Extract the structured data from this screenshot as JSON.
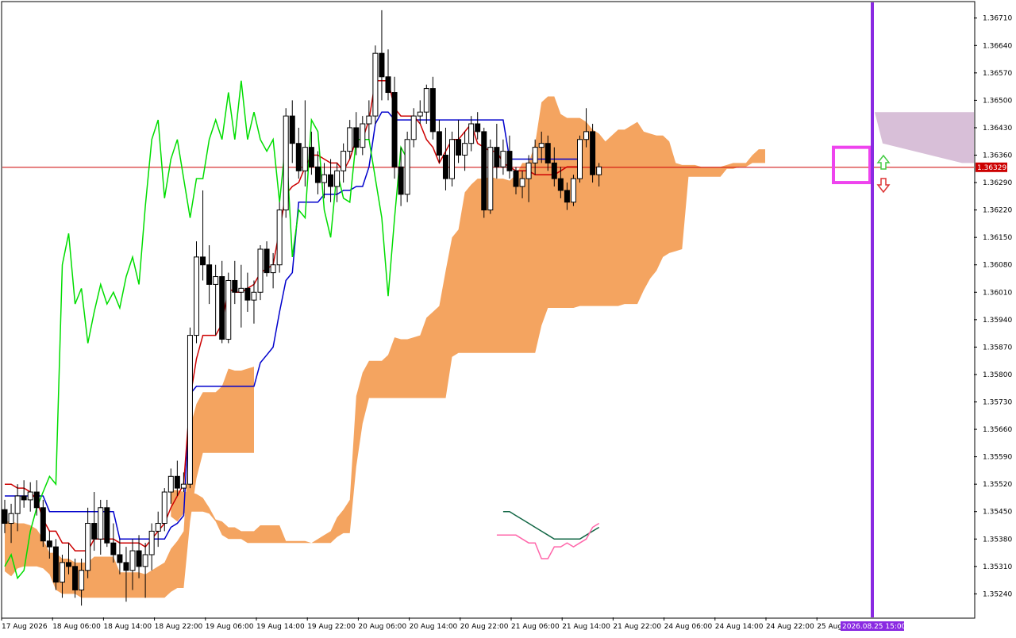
{
  "chart_data": {
    "type": "candlestick",
    "symbol_price_label": "1.36329",
    "current_price": 1.36329,
    "ylim": [
      1.3518,
      1.3675
    ],
    "yticks": [
      "1.36710",
      "1.36640",
      "1.36570",
      "1.36500",
      "1.36430",
      "1.36360",
      "1.36290",
      "1.36220",
      "1.36150",
      "1.36080",
      "1.36010",
      "1.35940",
      "1.35870",
      "1.35800",
      "1.35730",
      "1.35660",
      "1.35590",
      "1.35520",
      "1.35450",
      "1.35380",
      "1.35310",
      "1.35240"
    ],
    "xticks": [
      "17 Aug 2026",
      "18 Aug 06:00",
      "18 Aug 14:00",
      "18 Aug 22:00",
      "19 Aug 06:00",
      "19 Aug 14:00",
      "19 Aug 22:00",
      "20 Aug 06:00",
      "20 Aug 14:00",
      "20 Aug 22:00",
      "21 Aug 06:00",
      "21 Aug 14:00",
      "21 Aug 22:00",
      "24 Aug 06:00",
      "24 Aug 14:00",
      "24 Aug 22:00",
      "25 Aug"
    ],
    "cursor_time_label": "2026.08.25 15:00",
    "grid": false,
    "colors": {
      "tenkan": "#cc0000",
      "kijun": "#0000cc",
      "chikou": "#00dd00",
      "cloud_bull": "#f4a460",
      "cloud_bear": "#d8bfd8",
      "cursor": "#8a2be2",
      "price_line": "#cc0000",
      "box": "#ee44ee",
      "ma_fast": "#ff66aa",
      "ma_slow": "#116644",
      "arrow_up": "#44cc44",
      "arrow_down": "#dd3333"
    },
    "candles": [
      [
        1.35455,
        1.3548,
        1.35395,
        1.3542
      ],
      [
        1.3542,
        1.3547,
        1.3537,
        1.35445
      ],
      [
        1.35445,
        1.3552,
        1.354,
        1.3549
      ],
      [
        1.3549,
        1.3553,
        1.3546,
        1.3548
      ],
      [
        1.3548,
        1.35525,
        1.3545,
        1.355
      ],
      [
        1.355,
        1.3553,
        1.3544,
        1.3546
      ],
      [
        1.3546,
        1.3548,
        1.3536,
        1.35375
      ],
      [
        1.35375,
        1.354,
        1.3533,
        1.3536
      ],
      [
        1.3536,
        1.3538,
        1.3525,
        1.3527
      ],
      [
        1.3527,
        1.3534,
        1.3523,
        1.3532
      ],
      [
        1.3532,
        1.3537,
        1.3529,
        1.3531
      ],
      [
        1.3531,
        1.3533,
        1.3523,
        1.3525
      ],
      [
        1.3525,
        1.3533,
        1.3521,
        1.353
      ],
      [
        1.353,
        1.3546,
        1.3528,
        1.3542
      ],
      [
        1.3542,
        1.355,
        1.3535,
        1.3538
      ],
      [
        1.3538,
        1.3548,
        1.3534,
        1.3546
      ],
      [
        1.3546,
        1.3548,
        1.3536,
        1.3537
      ],
      [
        1.3537,
        1.3542,
        1.3532,
        1.3534
      ],
      [
        1.3534,
        1.3538,
        1.3529,
        1.3532
      ],
      [
        1.3532,
        1.3536,
        1.3522,
        1.353
      ],
      [
        1.353,
        1.3538,
        1.3525,
        1.3535
      ],
      [
        1.3535,
        1.3539,
        1.3528,
        1.3531
      ],
      [
        1.3531,
        1.3537,
        1.3523,
        1.3534
      ],
      [
        1.3534,
        1.3542,
        1.353,
        1.354
      ],
      [
        1.354,
        1.3545,
        1.3536,
        1.3542
      ],
      [
        1.3542,
        1.3551,
        1.354,
        1.355
      ],
      [
        1.355,
        1.3556,
        1.3547,
        1.3554
      ],
      [
        1.3554,
        1.3558,
        1.3549,
        1.3551
      ],
      [
        1.3551,
        1.3555,
        1.355,
        1.3552
      ],
      [
        1.3552,
        1.3592,
        1.3551,
        1.359
      ],
      [
        1.359,
        1.3614,
        1.3588,
        1.361
      ],
      [
        1.361,
        1.3627,
        1.3604,
        1.3608
      ],
      [
        1.3608,
        1.3613,
        1.3598,
        1.3603
      ],
      [
        1.3603,
        1.3608,
        1.359,
        1.3605
      ],
      [
        1.3605,
        1.3609,
        1.3588,
        1.3589
      ],
      [
        1.3589,
        1.3606,
        1.3588,
        1.3604
      ],
      [
        1.3604,
        1.3609,
        1.3598,
        1.3601
      ],
      [
        1.3601,
        1.3608,
        1.3592,
        1.3602
      ],
      [
        1.3602,
        1.3606,
        1.3596,
        1.3599
      ],
      [
        1.3599,
        1.3604,
        1.3593,
        1.3601
      ],
      [
        1.3601,
        1.3613,
        1.3599,
        1.3612
      ],
      [
        1.3612,
        1.3614,
        1.3605,
        1.3606
      ],
      [
        1.3606,
        1.3611,
        1.3602,
        1.3608
      ],
      [
        1.3608,
        1.3624,
        1.3606,
        1.3622
      ],
      [
        1.3622,
        1.3648,
        1.362,
        1.3646
      ],
      [
        1.3646,
        1.365,
        1.3634,
        1.3639
      ],
      [
        1.3639,
        1.3643,
        1.363,
        1.3632
      ],
      [
        1.3632,
        1.365,
        1.3628,
        1.3638
      ],
      [
        1.3638,
        1.3642,
        1.3631,
        1.3633
      ],
      [
        1.3633,
        1.3637,
        1.3626,
        1.3629
      ],
      [
        1.3629,
        1.3634,
        1.3625,
        1.3631
      ],
      [
        1.3631,
        1.3635,
        1.3624,
        1.3628
      ],
      [
        1.3628,
        1.3634,
        1.3624,
        1.3632
      ],
      [
        1.3632,
        1.3639,
        1.3629,
        1.3637
      ],
      [
        1.3637,
        1.3645,
        1.3635,
        1.3643
      ],
      [
        1.3643,
        1.3647,
        1.3636,
        1.3638
      ],
      [
        1.3638,
        1.3646,
        1.3636,
        1.3644
      ],
      [
        1.3644,
        1.365,
        1.364,
        1.3646
      ],
      [
        1.3646,
        1.3664,
        1.3644,
        1.3662
      ],
      [
        1.3662,
        1.3673,
        1.365,
        1.3656
      ],
      [
        1.3656,
        1.3663,
        1.365,
        1.3652
      ],
      [
        1.3652,
        1.3656,
        1.363,
        1.3633
      ],
      [
        1.3633,
        1.3638,
        1.3623,
        1.3626
      ],
      [
        1.3626,
        1.3642,
        1.3624,
        1.364
      ],
      [
        1.364,
        1.3648,
        1.3638,
        1.3646
      ],
      [
        1.3646,
        1.365,
        1.3644,
        1.3647
      ],
      [
        1.3647,
        1.3654,
        1.3644,
        1.3653
      ],
      [
        1.3653,
        1.3656,
        1.364,
        1.3642
      ],
      [
        1.3642,
        1.3645,
        1.3634,
        1.3636
      ],
      [
        1.3636,
        1.3643,
        1.3627,
        1.363
      ],
      [
        1.363,
        1.3642,
        1.3628,
        1.364
      ],
      [
        1.364,
        1.3645,
        1.3634,
        1.3636
      ],
      [
        1.3636,
        1.3642,
        1.3632,
        1.3639
      ],
      [
        1.3639,
        1.3646,
        1.3637,
        1.3644
      ],
      [
        1.3644,
        1.3647,
        1.364,
        1.3642
      ],
      [
        1.3642,
        1.3643,
        1.362,
        1.3622
      ],
      [
        1.3622,
        1.364,
        1.3621,
        1.3638
      ],
      [
        1.3638,
        1.3644,
        1.363,
        1.3633
      ],
      [
        1.3633,
        1.364,
        1.3631,
        1.3637
      ],
      [
        1.3637,
        1.3641,
        1.363,
        1.3632
      ],
      [
        1.3632,
        1.3633,
        1.3626,
        1.3628
      ],
      [
        1.3628,
        1.3632,
        1.3625,
        1.363
      ],
      [
        1.363,
        1.3636,
        1.3624,
        1.3634
      ],
      [
        1.3634,
        1.364,
        1.3631,
        1.3638
      ],
      [
        1.3638,
        1.3642,
        1.3634,
        1.3639
      ],
      [
        1.3639,
        1.3641,
        1.3632,
        1.3634
      ],
      [
        1.3634,
        1.3638,
        1.3628,
        1.363
      ],
      [
        1.363,
        1.3633,
        1.3625,
        1.3627
      ],
      [
        1.3627,
        1.3629,
        1.3622,
        1.3624
      ],
      [
        1.3624,
        1.3631,
        1.3623,
        1.363
      ],
      [
        1.363,
        1.3641,
        1.3629,
        1.364
      ],
      [
        1.364,
        1.3648,
        1.3638,
        1.3642
      ],
      [
        1.3642,
        1.3644,
        1.3629,
        1.3631
      ],
      [
        1.3631,
        1.3634,
        1.3628,
        1.3633
      ]
    ],
    "tenkan": [
      1.3552,
      1.3552,
      1.3551,
      1.3551,
      1.355,
      1.3548,
      1.3543,
      1.354,
      1.354,
      1.3537,
      1.3537,
      1.3535,
      1.3535,
      1.3535,
      1.3538,
      1.3538,
      1.3538,
      1.3538,
      1.3537,
      1.3537,
      1.3537,
      1.3537,
      1.3536,
      1.3538,
      1.354,
      1.3542,
      1.3546,
      1.3549,
      1.3552,
      1.3574,
      1.3584,
      1.359,
      1.359,
      1.359,
      1.3593,
      1.3602,
      1.3601,
      1.3601,
      1.3602,
      1.3603,
      1.3606,
      1.3607,
      1.3608,
      1.3617,
      1.3626,
      1.3628,
      1.3629,
      1.3633,
      1.3636,
      1.3636,
      1.3635,
      1.3634,
      1.3634,
      1.3632,
      1.3635,
      1.364,
      1.364,
      1.3645,
      1.3655,
      1.3655,
      1.3655,
      1.3648,
      1.3646,
      1.3646,
      1.3646,
      1.3644,
      1.364,
      1.3638,
      1.3634,
      1.3637,
      1.364,
      1.364,
      1.3642,
      1.3644,
      1.3639,
      1.3638,
      1.3637,
      1.3637,
      1.3634,
      1.3633,
      1.3632,
      1.3632,
      1.3632,
      1.3631,
      1.3631,
      1.3631,
      1.3631,
      1.3632,
      1.3633,
      1.3633,
      1.3633
    ],
    "kijun": [
      1.3549,
      1.3549,
      1.3549,
      1.3549,
      1.3549,
      1.3549,
      1.3549,
      1.3545,
      1.3545,
      1.3545,
      1.3545,
      1.3545,
      1.3545,
      1.3545,
      1.3545,
      1.3545,
      1.3545,
      1.3545,
      1.3538,
      1.3538,
      1.3538,
      1.3538,
      1.3538,
      1.3538,
      1.3538,
      1.3538,
      1.3541,
      1.3542,
      1.3544,
      1.3575,
      1.3577,
      1.3577,
      1.3577,
      1.3577,
      1.3577,
      1.3577,
      1.3577,
      1.3577,
      1.3577,
      1.3577,
      1.3583,
      1.3585,
      1.3587,
      1.3596,
      1.3604,
      1.3606,
      1.3624,
      1.3624,
      1.3624,
      1.3624,
      1.3626,
      1.3626,
      1.3626,
      1.3627,
      1.3627,
      1.3628,
      1.3628,
      1.3633,
      1.3644,
      1.3647,
      1.3647,
      1.3645,
      1.3645,
      1.3645,
      1.3645,
      1.3645,
      1.3645,
      1.3645,
      1.3645,
      1.3645,
      1.3645,
      1.3645,
      1.3645,
      1.3645,
      1.3645,
      1.3645,
      1.3645,
      1.3645,
      1.3645,
      1.3635,
      1.3635,
      1.3635,
      1.3635,
      1.3635,
      1.3635,
      1.3635,
      1.3635,
      1.3635,
      1.3635,
      1.3635,
      1.3635
    ],
    "chikou": [
      1.3531,
      1.3534,
      1.3528,
      1.353,
      1.354,
      1.3546,
      1.355,
      1.3554,
      1.3552,
      1.3608,
      1.3616,
      1.3598,
      1.3602,
      1.3588,
      1.3596,
      1.3603,
      1.3598,
      1.3601,
      1.3597,
      1.3605,
      1.361,
      1.3603,
      1.3623,
      1.364,
      1.3645,
      1.3625,
      1.3635,
      1.364,
      1.363,
      1.362,
      1.363,
      1.363,
      1.364,
      1.3645,
      1.364,
      1.3652,
      1.364,
      1.3655,
      1.364,
      1.3647,
      1.364,
      1.3637,
      1.364,
      1.3624,
      1.364,
      1.361,
      1.3622,
      1.362,
      1.3645,
      1.3642,
      1.3622,
      1.3615,
      1.3632,
      1.3625,
      1.3624,
      1.364,
      1.364,
      1.364,
      1.363,
      1.362,
      1.36,
      1.362,
      1.3638,
      1.3635
    ],
    "ma_fast": [
      1.3539,
      1.3539,
      1.3539,
      1.3539,
      1.3538,
      1.3537,
      1.3537,
      1.3533,
      1.3533,
      1.3536,
      1.3536,
      1.3537,
      1.3536,
      1.3537,
      1.3538,
      1.3541,
      1.3542
    ],
    "ma_slow": [
      1.3545,
      1.3545,
      1.3544,
      1.3543,
      1.3542,
      1.3541,
      1.354,
      1.3539,
      1.3538,
      1.3538,
      1.3538,
      1.3538,
      1.3538,
      1.3539,
      1.354,
      1.3541
    ]
  }
}
